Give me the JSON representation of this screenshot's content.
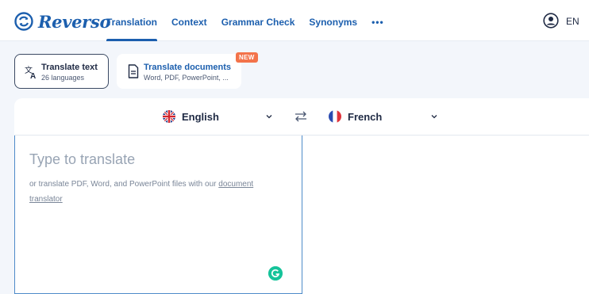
{
  "app": {
    "brand": "Reverso",
    "language_code": "EN"
  },
  "nav": {
    "items": [
      {
        "label": "Translation",
        "active": true
      },
      {
        "label": "Context"
      },
      {
        "label": "Grammar Check"
      },
      {
        "label": "Synonyms"
      },
      {
        "label": "•••"
      }
    ]
  },
  "modes": {
    "text": {
      "title": "Translate text",
      "subtitle": "26 languages",
      "icon": "translate-icon"
    },
    "documents": {
      "title": "Translate documents",
      "subtitle": "Word, PDF, PowerPoint, ...",
      "badge": "NEW",
      "icon": "document-icon"
    }
  },
  "languages": {
    "source": {
      "label": "English",
      "flag": "uk-flag-icon"
    },
    "target": {
      "label": "French",
      "flag": "france-flag-icon"
    }
  },
  "editor": {
    "placeholder": "Type to translate",
    "hint_prefix": "or translate PDF, Word, and PowerPoint files with our ",
    "hint_link": "document translator"
  },
  "colors": {
    "brand": "#1c5fae",
    "badge": "#f3734a",
    "grammarly": "#15c39a",
    "focus_border": "#4e8bc9"
  }
}
